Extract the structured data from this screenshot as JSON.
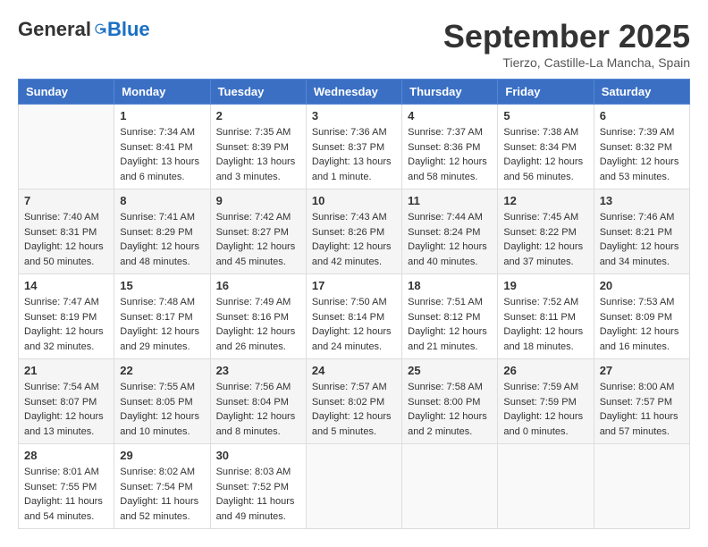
{
  "logo": {
    "general": "General",
    "blue": "Blue"
  },
  "header": {
    "month": "September 2025",
    "location": "Tierzo, Castille-La Mancha, Spain"
  },
  "weekdays": [
    "Sunday",
    "Monday",
    "Tuesday",
    "Wednesday",
    "Thursday",
    "Friday",
    "Saturday"
  ],
  "weeks": [
    [
      {
        "day": "",
        "empty": true
      },
      {
        "day": "1",
        "sunrise": "7:34 AM",
        "sunset": "8:41 PM",
        "daylight": "13 hours and 6 minutes."
      },
      {
        "day": "2",
        "sunrise": "7:35 AM",
        "sunset": "8:39 PM",
        "daylight": "13 hours and 3 minutes."
      },
      {
        "day": "3",
        "sunrise": "7:36 AM",
        "sunset": "8:37 PM",
        "daylight": "13 hours and 1 minute."
      },
      {
        "day": "4",
        "sunrise": "7:37 AM",
        "sunset": "8:36 PM",
        "daylight": "12 hours and 58 minutes."
      },
      {
        "day": "5",
        "sunrise": "7:38 AM",
        "sunset": "8:34 PM",
        "daylight": "12 hours and 56 minutes."
      },
      {
        "day": "6",
        "sunrise": "7:39 AM",
        "sunset": "8:32 PM",
        "daylight": "12 hours and 53 minutes."
      }
    ],
    [
      {
        "day": "7",
        "sunrise": "7:40 AM",
        "sunset": "8:31 PM",
        "daylight": "12 hours and 50 minutes."
      },
      {
        "day": "8",
        "sunrise": "7:41 AM",
        "sunset": "8:29 PM",
        "daylight": "12 hours and 48 minutes."
      },
      {
        "day": "9",
        "sunrise": "7:42 AM",
        "sunset": "8:27 PM",
        "daylight": "12 hours and 45 minutes."
      },
      {
        "day": "10",
        "sunrise": "7:43 AM",
        "sunset": "8:26 PM",
        "daylight": "12 hours and 42 minutes."
      },
      {
        "day": "11",
        "sunrise": "7:44 AM",
        "sunset": "8:24 PM",
        "daylight": "12 hours and 40 minutes."
      },
      {
        "day": "12",
        "sunrise": "7:45 AM",
        "sunset": "8:22 PM",
        "daylight": "12 hours and 37 minutes."
      },
      {
        "day": "13",
        "sunrise": "7:46 AM",
        "sunset": "8:21 PM",
        "daylight": "12 hours and 34 minutes."
      }
    ],
    [
      {
        "day": "14",
        "sunrise": "7:47 AM",
        "sunset": "8:19 PM",
        "daylight": "12 hours and 32 minutes."
      },
      {
        "day": "15",
        "sunrise": "7:48 AM",
        "sunset": "8:17 PM",
        "daylight": "12 hours and 29 minutes."
      },
      {
        "day": "16",
        "sunrise": "7:49 AM",
        "sunset": "8:16 PM",
        "daylight": "12 hours and 26 minutes."
      },
      {
        "day": "17",
        "sunrise": "7:50 AM",
        "sunset": "8:14 PM",
        "daylight": "12 hours and 24 minutes."
      },
      {
        "day": "18",
        "sunrise": "7:51 AM",
        "sunset": "8:12 PM",
        "daylight": "12 hours and 21 minutes."
      },
      {
        "day": "19",
        "sunrise": "7:52 AM",
        "sunset": "8:11 PM",
        "daylight": "12 hours and 18 minutes."
      },
      {
        "day": "20",
        "sunrise": "7:53 AM",
        "sunset": "8:09 PM",
        "daylight": "12 hours and 16 minutes."
      }
    ],
    [
      {
        "day": "21",
        "sunrise": "7:54 AM",
        "sunset": "8:07 PM",
        "daylight": "12 hours and 13 minutes."
      },
      {
        "day": "22",
        "sunrise": "7:55 AM",
        "sunset": "8:05 PM",
        "daylight": "12 hours and 10 minutes."
      },
      {
        "day": "23",
        "sunrise": "7:56 AM",
        "sunset": "8:04 PM",
        "daylight": "12 hours and 8 minutes."
      },
      {
        "day": "24",
        "sunrise": "7:57 AM",
        "sunset": "8:02 PM",
        "daylight": "12 hours and 5 minutes."
      },
      {
        "day": "25",
        "sunrise": "7:58 AM",
        "sunset": "8:00 PM",
        "daylight": "12 hours and 2 minutes."
      },
      {
        "day": "26",
        "sunrise": "7:59 AM",
        "sunset": "7:59 PM",
        "daylight": "12 hours and 0 minutes."
      },
      {
        "day": "27",
        "sunrise": "8:00 AM",
        "sunset": "7:57 PM",
        "daylight": "11 hours and 57 minutes."
      }
    ],
    [
      {
        "day": "28",
        "sunrise": "8:01 AM",
        "sunset": "7:55 PM",
        "daylight": "11 hours and 54 minutes."
      },
      {
        "day": "29",
        "sunrise": "8:02 AM",
        "sunset": "7:54 PM",
        "daylight": "11 hours and 52 minutes."
      },
      {
        "day": "30",
        "sunrise": "8:03 AM",
        "sunset": "7:52 PM",
        "daylight": "11 hours and 49 minutes."
      },
      {
        "day": "",
        "empty": true
      },
      {
        "day": "",
        "empty": true
      },
      {
        "day": "",
        "empty": true
      },
      {
        "day": "",
        "empty": true
      }
    ]
  ],
  "labels": {
    "sunrise": "Sunrise:",
    "sunset": "Sunset:",
    "daylight": "Daylight:"
  }
}
